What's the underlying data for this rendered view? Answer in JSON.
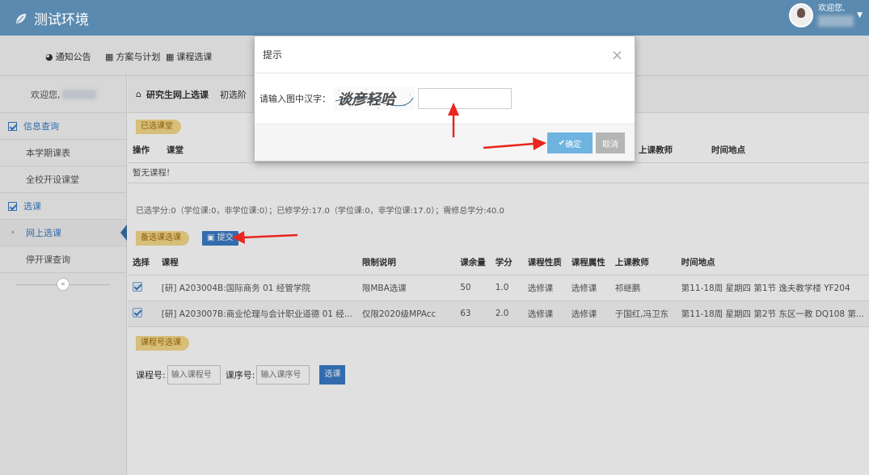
{
  "app": {
    "title": "测试环境"
  },
  "user": {
    "greeting": "欢迎您,"
  },
  "nav": [
    {
      "label": "通知公告",
      "icon": "globe-icon"
    },
    {
      "label": "方案与计划",
      "icon": "calendar-icon"
    },
    {
      "label": "课程选课",
      "icon": "calendar-icon"
    }
  ],
  "sidebar": {
    "welcome": "欢迎您,",
    "sections": [
      {
        "label": "信息查询",
        "items": [
          "本学期课表",
          "全校开设课堂"
        ]
      },
      {
        "label": "选课",
        "items": [
          "网上选课",
          "停开课查询"
        ]
      }
    ],
    "collapse": "«"
  },
  "breadcrumb": {
    "title": "研究生网上选课",
    "sub": "初选阶"
  },
  "selected": {
    "tag": "已选课堂",
    "headers": [
      "操作",
      "课堂",
      "",
      "",
      "",
      "",
      "",
      "上课教师",
      "时间地点"
    ],
    "empty": "暂无课程!"
  },
  "credits": "已选学分:0（学位课:0，非学位课:0）；已修学分:17.0（学位课:0，非学位课:17.0）；需修总学分:40.0",
  "candidate": {
    "tag": "备选课选课",
    "submit": "提交",
    "headers": [
      "选择",
      "课程",
      "限制说明",
      "课余量",
      "学分",
      "课程性质",
      "课程属性",
      "上课教师",
      "时间地点"
    ],
    "rows": [
      [
        "[研] A203004B:国际商务 01 经管学院",
        "限MBA选课",
        "50",
        "1.0",
        "选修课",
        "选修课",
        "祁继鹏",
        "第11-18周 星期四 第1节 逸夫教学楼 YF204"
      ],
      [
        "[研] A203007B:商业伦理与会计职业道德 01 经...",
        "仅限2020级MPAcc",
        "63",
        "2.0",
        "选修课",
        "选修课",
        "于国红,冯卫东",
        "第11-18周 星期四 第2节 东区一教 DQ108 第..."
      ]
    ]
  },
  "course_search": {
    "tag": "课程号选课",
    "course_label": "课程号:",
    "course_placeholder": "输入课程号",
    "seq_label": "课序号:",
    "seq_placeholder": "输入课序号",
    "button": "选课"
  },
  "modal": {
    "title": "提示",
    "close": "×",
    "prompt": "请输入图中汉字：",
    "captcha_text": "谈彦轻哈",
    "ok": "确定",
    "cancel": "取消"
  },
  "colors": {
    "topbar": "#5b8ab0",
    "accent": "#3a7cc7",
    "annotation": "#e8261e"
  }
}
